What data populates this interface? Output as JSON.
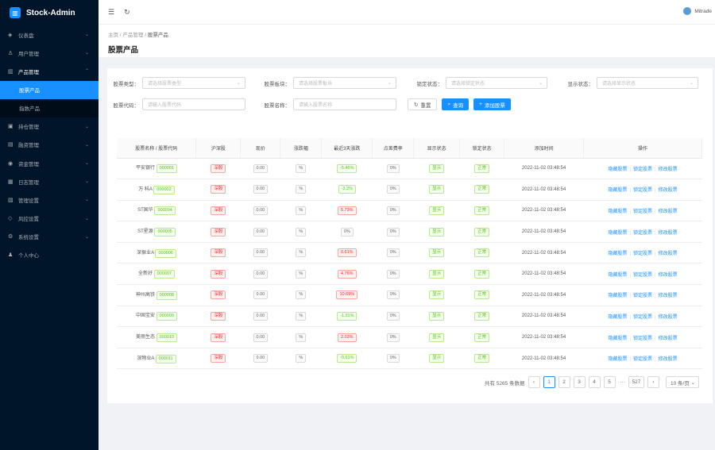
{
  "app": {
    "title": "Stock-Admin"
  },
  "sidebar": {
    "items": [
      {
        "label": "仪表盘",
        "icon": "dashboard-icon",
        "glyph": "◈"
      },
      {
        "label": "用户管理",
        "icon": "user-icon",
        "glyph": "♙"
      },
      {
        "label": "产品管理",
        "icon": "chart-icon",
        "glyph": "▥",
        "open": true
      },
      {
        "label": "持仓管理",
        "icon": "box-icon",
        "glyph": "▣"
      },
      {
        "label": "融资管理",
        "icon": "money-icon",
        "glyph": "▤"
      },
      {
        "label": "资金管理",
        "icon": "wallet-icon",
        "glyph": "◉"
      },
      {
        "label": "日志管理",
        "icon": "log-icon",
        "glyph": "▦"
      },
      {
        "label": "管理设置",
        "icon": "setting-icon",
        "glyph": "▧"
      },
      {
        "label": "风控设置",
        "icon": "shield-icon",
        "glyph": "◇"
      },
      {
        "label": "系统设置",
        "icon": "gear-icon",
        "glyph": "⚙"
      },
      {
        "label": "个人中心",
        "icon": "person-icon",
        "glyph": "♟"
      }
    ],
    "submenu": [
      {
        "label": "股票产品",
        "active": true
      },
      {
        "label": "指数产品",
        "active": false
      }
    ]
  },
  "header": {
    "user": "Mitrade"
  },
  "breadcrumb": {
    "home": "主页",
    "mid": "产品管理",
    "current": "股票产品"
  },
  "page": {
    "title": "股票产品"
  },
  "filters": {
    "market_label": "股票类型：",
    "market_placeholder": "请选择股票类型",
    "plate_label": "股票板块：",
    "plate_placeholder": "请选择股票板块",
    "lock_label": "锁定状态：",
    "lock_placeholder": "请选择锁定状态",
    "show_label": "显示状态：",
    "show_placeholder": "请选择显示状态",
    "code_label": "股票代码：",
    "code_placeholder": "请输入股票代码",
    "name_label": "股票名称：",
    "name_placeholder": "请输入股票名称",
    "reset": "重置",
    "query": "查询",
    "add": "添加股票"
  },
  "table": {
    "columns": [
      "股票名称 / 股票代码",
      "沪深股",
      "现价",
      "涨跌幅",
      "最近3天涨跌",
      "点差费率",
      "显示状态",
      "锁定状态",
      "添加时间",
      "操作"
    ],
    "rows": [
      {
        "name": "平安银行",
        "code": "000001",
        "market": "深股",
        "price": "0.00",
        "change": "%",
        "trend": "-5.46%",
        "trend_type": "g",
        "spread": "0%",
        "show": "显示",
        "lock": "正常",
        "time": "2022-11-02 03:48:54"
      },
      {
        "name": "万 科A",
        "code": "000002",
        "market": "深股",
        "price": "0.00",
        "change": "%",
        "trend": "-3.2%",
        "trend_type": "g",
        "spread": "0%",
        "show": "显示",
        "lock": "正常",
        "time": "2022-11-02 03:48:54"
      },
      {
        "name": "ST国华",
        "code": "000004",
        "market": "深股",
        "price": "0.00",
        "change": "%",
        "trend": "5.73%",
        "trend_type": "r",
        "spread": "0%",
        "show": "显示",
        "lock": "正常",
        "time": "2022-11-02 03:48:54"
      },
      {
        "name": "ST星源",
        "code": "000005",
        "market": "深股",
        "price": "0.00",
        "change": "%",
        "trend": "0%",
        "trend_type": "n",
        "spread": "0%",
        "show": "显示",
        "lock": "正常",
        "time": "2022-11-02 03:48:54"
      },
      {
        "name": "深振业A",
        "code": "000006",
        "market": "深股",
        "price": "0.00",
        "change": "%",
        "trend": "0.61%",
        "trend_type": "r",
        "spread": "0%",
        "show": "显示",
        "lock": "正常",
        "time": "2022-11-02 03:48:54"
      },
      {
        "name": "全新好",
        "code": "000007",
        "market": "深股",
        "price": "0.00",
        "change": "%",
        "trend": "4.76%",
        "trend_type": "r",
        "spread": "0%",
        "show": "显示",
        "lock": "正常",
        "time": "2022-11-02 03:48:54"
      },
      {
        "name": "神州高铁",
        "code": "000008",
        "market": "深股",
        "price": "0.00",
        "change": "%",
        "trend": "10.69%",
        "trend_type": "r",
        "spread": "0%",
        "show": "显示",
        "lock": "正常",
        "time": "2022-11-02 03:48:54"
      },
      {
        "name": "中国宝安",
        "code": "000009",
        "market": "深股",
        "price": "0.00",
        "change": "%",
        "trend": "-1.31%",
        "trend_type": "g",
        "spread": "0%",
        "show": "显示",
        "lock": "正常",
        "time": "2022-11-02 03:48:54"
      },
      {
        "name": "美丽生态",
        "code": "000010",
        "market": "深股",
        "price": "0.00",
        "change": "%",
        "trend": "2.02%",
        "trend_type": "r",
        "spread": "0%",
        "show": "显示",
        "lock": "正常",
        "time": "2022-11-02 03:48:54"
      },
      {
        "name": "深物业A",
        "code": "000011",
        "market": "深股",
        "price": "0.00",
        "change": "%",
        "trend": "-0.61%",
        "trend_type": "g",
        "spread": "0%",
        "show": "显示",
        "lock": "正常",
        "time": "2022-11-02 03:48:54"
      }
    ],
    "actions": [
      "隐藏股票",
      "锁定股票",
      "修改股票"
    ]
  },
  "pagination": {
    "total": "共有 5265 条数据",
    "pages": [
      "1",
      "2",
      "3",
      "4",
      "5"
    ],
    "ellipsis": "···",
    "last": "527",
    "size": "10 条/页",
    "current": "1"
  },
  "colors": {
    "accent": "#1890ff",
    "sidebar_bg": "#001529",
    "up": "#f5222d",
    "down": "#52c41a"
  }
}
